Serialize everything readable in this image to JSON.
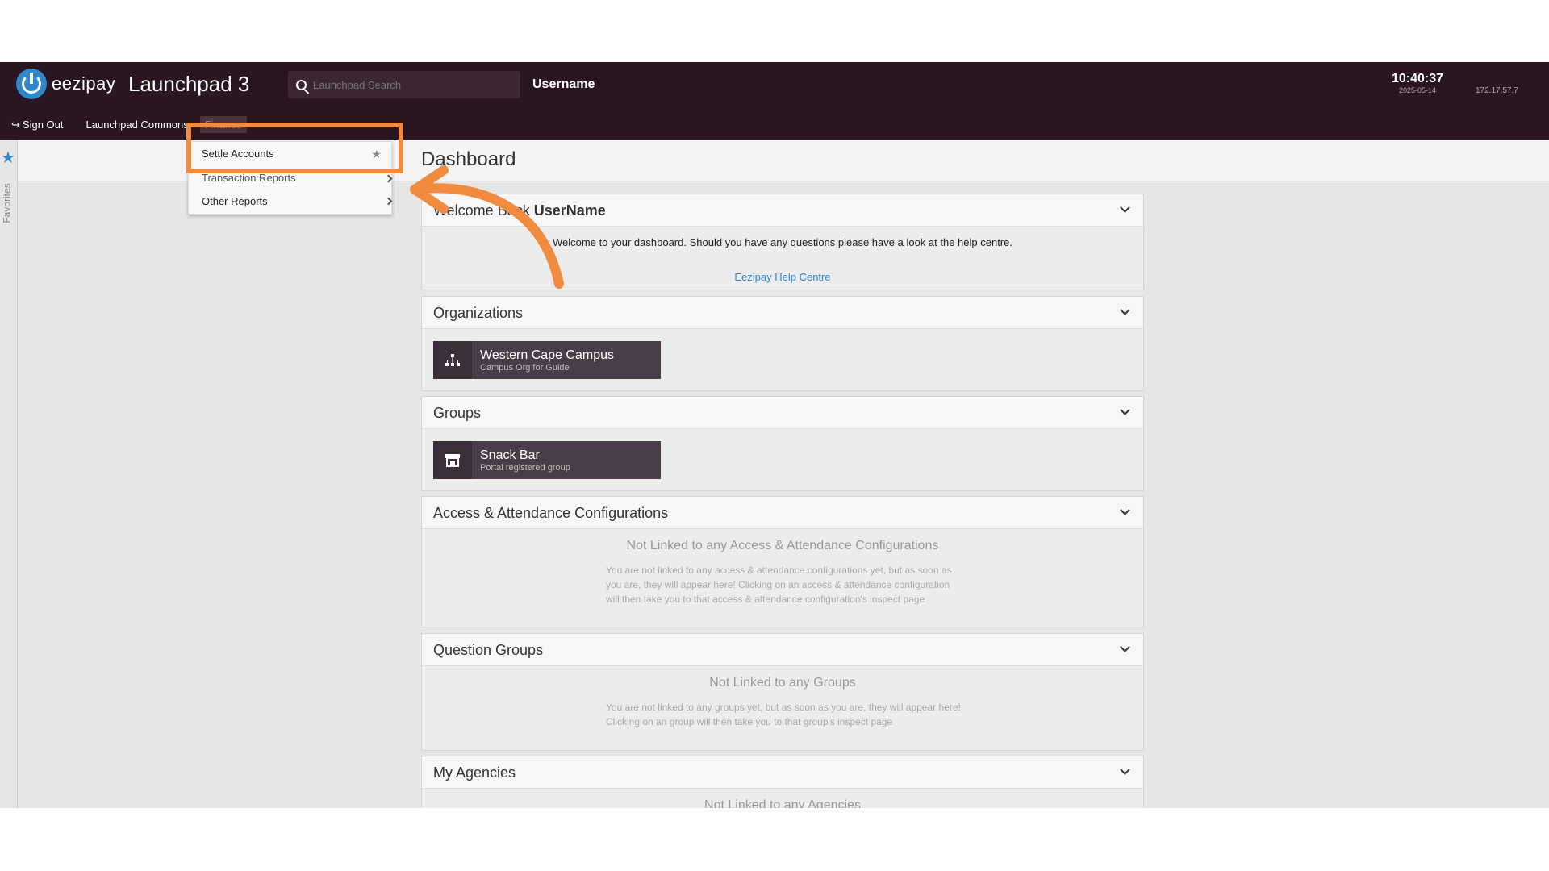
{
  "app": {
    "brand": "eezipay",
    "title": "Launchpad 3",
    "search_placeholder": "Launchpad Search",
    "username": "Username",
    "time": "10:40:37",
    "date": "2025-05-14",
    "ip": "172.17.57.7"
  },
  "nav": {
    "sign_out": "Sign Out",
    "commons": "Launchpad Commons",
    "finance": "Finance"
  },
  "favorites_label": "Favorites",
  "menu": {
    "items": [
      {
        "label": "Settle Accounts"
      },
      {
        "label": "Transaction Reports"
      },
      {
        "label": "Other Reports"
      }
    ]
  },
  "dashboard": {
    "title": "Dashboard",
    "welcome": {
      "title_prefix": "Welcome Back ",
      "title_name": "UserName",
      "message": "Welcome to your dashboard. Should you have any questions please have a look at the help centre.",
      "help_link": "Eezipay Help Centre"
    },
    "organizations": {
      "title": "Organizations",
      "tile_name": "Western Cape Campus",
      "tile_sub": "Campus Org for Guide"
    },
    "groups": {
      "title": "Groups",
      "tile_name": "Snack Bar",
      "tile_sub": "Portal registered group"
    },
    "access": {
      "title": "Access & Attendance Configurations",
      "empty_title": "Not Linked to any Access & Attendance Configurations",
      "empty_desc": "You are not linked to any access & attendance configurations yet, but as soon as you are, they will appear here! Clicking on an access & attendance configuration will then take you to that access & attendance configuration's inspect page"
    },
    "question_groups": {
      "title": "Question Groups",
      "empty_title": "Not Linked to any Groups",
      "empty_desc": "You are not linked to any groups yet, but as soon as you are, they will appear here! Clicking on an group will then take you to that group's inspect page"
    },
    "agencies": {
      "title": "My Agencies",
      "empty_title": "Not Linked to any Agencies"
    }
  },
  "colors": {
    "topbar": "#2a1621",
    "accent": "#2f86c9",
    "highlight": "#f18b3f",
    "tile": "#4a3d4a"
  }
}
